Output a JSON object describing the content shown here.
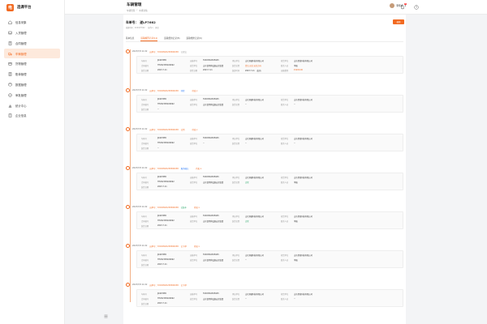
{
  "sidebar": {
    "logo_mark": "电",
    "logo_text": "选课平台",
    "items": [
      {
        "label": "信息采集",
        "icon": "home-icon"
      },
      {
        "label": "入货管理",
        "icon": "inbox-icon"
      },
      {
        "label": "合同管理",
        "icon": "contract-icon"
      },
      {
        "label": "车辆管理",
        "icon": "truck-icon",
        "active": true
      },
      {
        "label": "货物管理",
        "icon": "package-icon"
      },
      {
        "label": "账单管理",
        "icon": "bill-icon"
      },
      {
        "label": "数据管理",
        "icon": "data-icon"
      },
      {
        "label": "审批管理",
        "icon": "approval-icon"
      },
      {
        "label": "统计中心",
        "icon": "chart-icon"
      },
      {
        "label": "企业信息",
        "icon": "building-icon"
      }
    ]
  },
  "header": {
    "title": "车辆管理",
    "breadcrumb": [
      "车辆管理",
      "/",
      "车辆详情"
    ],
    "notif_badge": "9",
    "user_name": "李伟成"
  },
  "detail": {
    "order_label": "车单号：",
    "order_no": "遂LP7662",
    "meta": [
      "创建时间：2023/07/02",
      "操作人：黄金"
    ],
    "action_label": "编辑"
  },
  "tabs": [
    "基本信息",
    "运输履历记录(11)",
    "运输费用记录(8)",
    "运输维修记录(6)"
  ],
  "events": [
    {
      "time": "2023/7/8 11:02",
      "ref": "运单号：SYC00520230500038",
      "status": "已提交",
      "status_color": "#999999",
      "tag": "",
      "rows": [
        [
          [
            "车辆号",
            "JK403585"
          ],
          [
            "运输单号",
            "HUU0562305645"
          ],
          [
            "承运单位",
            "山东港通科技有限公司"
          ],
          [
            "收货单位",
            "山东星创科技有限公司"
          ]
        ],
        [
          [
            "合同编号",
            "HT202305020092"
          ],
          [
            "发货单位",
            "山东省特种设备安全监督"
          ],
          [
            "装货位置",
            "青岛 运往 运往方向"
          ],
          [
            "联系人员",
            "李强"
          ]
        ],
        [
          [
            "装货日期",
            "2023.7.11"
          ],
          [
            "卸货日期",
            "2023.7.11"
          ],
          [
            "装卸时间",
            "2023.7.11 （出开）"
          ],
          [
            "运输费用",
            "¥1200.00"
          ]
        ]
      ]
    },
    {
      "time": "2023/7/8 11:02",
      "ref": "运单号：SYC00520230500038",
      "status": "待检",
      "status_color": "#2f7cf6",
      "tag": "待发 ▾",
      "rows": [
        [
          [
            "车辆号",
            "JK403585"
          ],
          [
            "运输单号",
            "HUU0562305645"
          ],
          [
            "承运单位",
            "山东港通科技有限公司"
          ],
          [
            "收货单位",
            "山东星创科技有限公司"
          ]
        ],
        [
          [
            "合同编号",
            "HT202305020092"
          ],
          [
            "发货单位",
            "山东省特种设备安全监督"
          ],
          [
            "装货位置",
            "--"
          ],
          [
            "联系人员",
            "--"
          ]
        ],
        [
          [
            "装货日期",
            "--"
          ],
          [
            "",
            ""
          ],
          [
            "",
            ""
          ],
          [
            "",
            ""
          ]
        ]
      ]
    },
    {
      "time": "2023/7/8 11:02",
      "ref": "运单号：SYC00520230500038",
      "status": "已到",
      "status_color": "#f26a21",
      "tag": "待发 ▾",
      "rows": [
        [
          [
            "车辆号",
            "JK403585"
          ],
          [
            "运输单号",
            "HUU0562305645"
          ],
          [
            "承运单位",
            "山东港通科技有限公司"
          ],
          [
            "收货单位",
            "山东星创科技有限公司"
          ]
        ],
        [
          [
            "合同编号",
            "HT202305020092"
          ],
          [
            "发货单位",
            "--"
          ],
          [
            "装货位置",
            "--"
          ],
          [
            "联系人员",
            "--"
          ]
        ],
        [
          [
            "装货日期",
            "--"
          ],
          [
            "",
            ""
          ],
          [
            "",
            ""
          ],
          [
            "",
            ""
          ]
        ]
      ]
    },
    {
      "time": "2023/7/8 11:02",
      "ref": "运单号：SYC00520230500038",
      "status": "服务确认",
      "status_color": "#2f7cf6",
      "tag": "待发 ▾",
      "rows": [
        [
          [
            "车辆号",
            "JK403585"
          ],
          [
            "运输单号",
            "HUU0562305645"
          ],
          [
            "承运单位",
            "山东港通科技有限公司"
          ],
          [
            "收货单位",
            "山东星创科技有限公司"
          ]
        ],
        [
          [
            "合同编号",
            "HT202305020092"
          ],
          [
            "发货单位",
            "山东省特种设备安全监督"
          ],
          [
            "装货位置",
            "正常"
          ],
          [
            "联系人员",
            "李强"
          ]
        ],
        [
          [
            "装货日期",
            "2023.7.11"
          ],
          [
            "",
            ""
          ],
          [
            "",
            ""
          ],
          [
            "",
            ""
          ]
        ]
      ]
    },
    {
      "time": "2023/7/8 11:02",
      "ref": "运单号：SYC00520230500038",
      "status": "已装车",
      "status_color": "#1aa260",
      "tag": "待发 ▾",
      "rows": [
        [
          [
            "车辆号",
            "JK403585"
          ],
          [
            "运输单号",
            "HUU0562305645"
          ],
          [
            "承运单位",
            "山东港通科技有限公司"
          ],
          [
            "收货单位",
            "山东星创科技有限公司"
          ]
        ],
        [
          [
            "合同编号",
            "HT202305020092"
          ],
          [
            "发货单位",
            "山东省特种设备安全监督"
          ],
          [
            "装货位置",
            "正常"
          ],
          [
            "联系人员",
            "李强"
          ]
        ],
        [
          [
            "装货日期",
            "2023.7.11"
          ],
          [
            "",
            ""
          ],
          [
            "",
            ""
          ],
          [
            "",
            ""
          ]
        ]
      ]
    },
    {
      "time": "2023/7/8 11:02",
      "ref": "运单号：SYC00520230500038",
      "status": "已下单",
      "status_color": "#f26a21",
      "tag": "待发 ▾",
      "rows": [
        [
          [
            "车辆号",
            "JK403585"
          ],
          [
            "运输单号",
            "HUU0562305645"
          ],
          [
            "承运单位",
            "山东港通科技有限公司"
          ],
          [
            "收货单位",
            "山东星创科技有限公司"
          ]
        ],
        [
          [
            "合同编号",
            "HT202305020092"
          ],
          [
            "发货单位",
            "山东省特种设备安全监督"
          ],
          [
            "装货位置",
            "--"
          ],
          [
            "联系人员",
            "李强"
          ]
        ],
        [
          [
            "装货日期",
            "2023.7.11"
          ],
          [
            "",
            ""
          ],
          [
            "",
            ""
          ],
          [
            "",
            ""
          ]
        ]
      ]
    },
    {
      "time": "2023/7/8 11:02",
      "ref": "运单号：SYC00520230500038",
      "status": "已下单",
      "status_color": "#f26a21",
      "tag": "",
      "rows": [
        [
          [
            "车辆号",
            "JK403585"
          ],
          [
            "运输单号",
            "HUU0562305645"
          ],
          [
            "承运单位",
            "山东港通科技有限公司"
          ],
          [
            "收货单位",
            "山东星创科技有限公司"
          ]
        ],
        [
          [
            "合同编号",
            "HT202305020092"
          ],
          [
            "发货单位",
            "山东省特种设备安全监督"
          ],
          [
            "装货位置",
            "--"
          ],
          [
            "联系人员",
            "--"
          ]
        ],
        [
          [
            "装货日期",
            "2023.7.11"
          ],
          [
            "",
            ""
          ],
          [
            "",
            ""
          ],
          [
            "",
            ""
          ]
        ]
      ]
    }
  ]
}
